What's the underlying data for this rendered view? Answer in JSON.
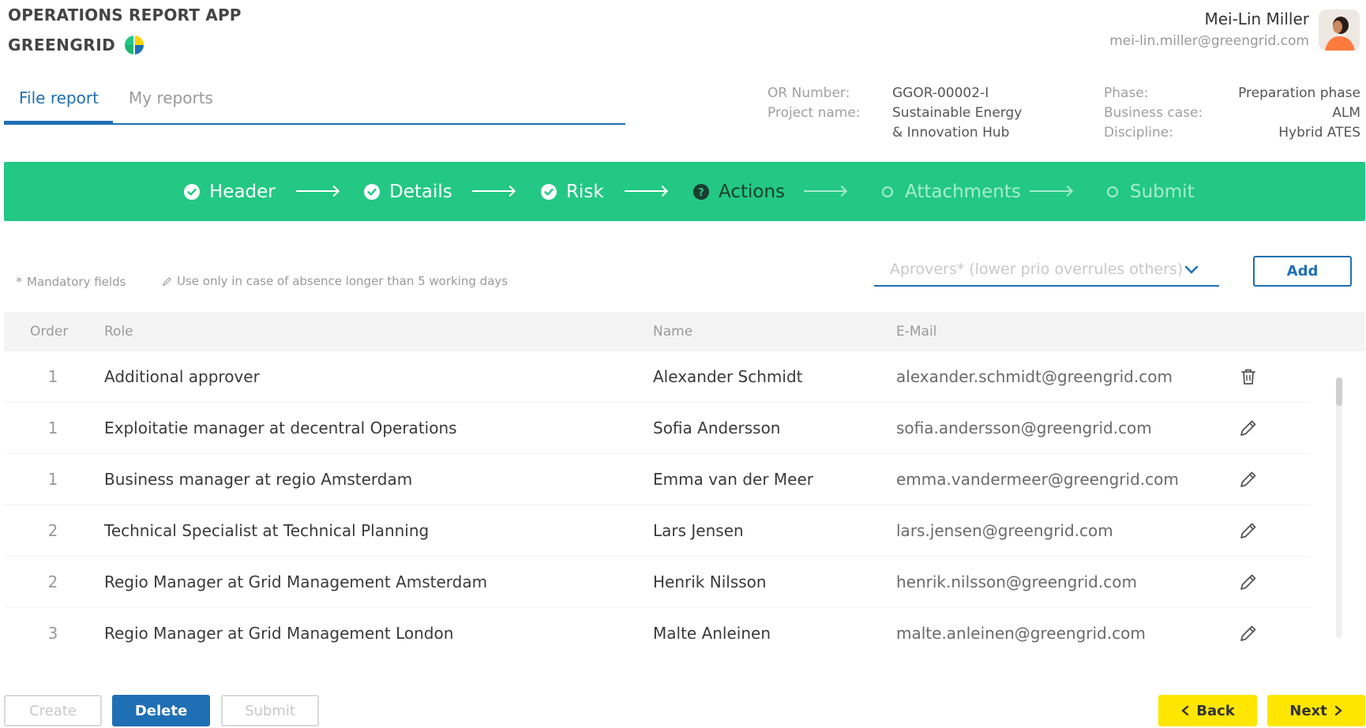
{
  "app": {
    "title": "OPERATIONS REPORT APP",
    "brand": "GREENGRID"
  },
  "user": {
    "name": "Mei-Lin Miller",
    "email": "mei-lin.miller@greengrid.com"
  },
  "tabs": [
    {
      "label": "File report",
      "active": true
    },
    {
      "label": "My reports",
      "active": false
    }
  ],
  "report": {
    "or_number_label": "OR Number:",
    "or_number": "GGOR-00002-I",
    "project_label": "Project name:",
    "project_line1": "Sustainable Energy",
    "project_line2": "& Innovation Hub",
    "phase_label": "Phase:",
    "phase": "Preparation phase",
    "business_case_label": "Business case:",
    "business_case": "ALM",
    "discipline_label": "Discipline:",
    "discipline": "Hybrid ATES"
  },
  "steps": [
    {
      "label": "Header",
      "state": "done"
    },
    {
      "label": "Details",
      "state": "done"
    },
    {
      "label": "Risk",
      "state": "done"
    },
    {
      "label": "Actions",
      "state": "current"
    },
    {
      "label": "Attachments",
      "state": "future"
    },
    {
      "label": "Submit",
      "state": "future"
    }
  ],
  "hints": {
    "mandatory": "Mandatory fields",
    "absence": "Use only in case of absence longer than 5 working days"
  },
  "approver_select": {
    "placeholder": "Aprovers* (lower prio overrules others)"
  },
  "add_label": "Add",
  "table": {
    "headers": {
      "order": "Order",
      "role": "Role",
      "name": "Name",
      "email": "E-Mail"
    },
    "rows": [
      {
        "order": "1",
        "role": "Additional approver",
        "name": "Alexander Schmidt",
        "email": "alexander.schmidt@greengrid.com",
        "action": "delete"
      },
      {
        "order": "1",
        "role": "Exploitatie manager at decentral Operations",
        "name": "Sofia Andersson",
        "email": "sofia.andersson@greengrid.com",
        "action": "edit"
      },
      {
        "order": "1",
        "role": "Business manager at regio Amsterdam",
        "name": "Emma van der Meer",
        "email": "emma.vandermeer@greengrid.com",
        "action": "edit"
      },
      {
        "order": "2",
        "role": "Technical Specialist at Technical Planning",
        "name": "Lars Jensen",
        "email": "lars.jensen@greengrid.com",
        "action": "edit"
      },
      {
        "order": "2",
        "role": "Regio Manager at Grid Management Amsterdam",
        "name": "Henrik Nilsson",
        "email": "henrik.nilsson@greengrid.com",
        "action": "edit"
      },
      {
        "order": "3",
        "role": "Regio Manager at Grid Management London",
        "name": "Malte Anleinen",
        "email": "malte.anleinen@greengrid.com",
        "action": "edit"
      }
    ]
  },
  "footer": {
    "create": "Create",
    "delete": "Delete",
    "submit": "Submit",
    "back": "Back",
    "next": "Next"
  },
  "colors": {
    "accent": "#1f6fb5",
    "stepper": "#22c883",
    "nav_button": "#ffe600"
  },
  "icons": {
    "done_step": "check-circle-icon",
    "current_step": "help-circle-icon",
    "future_step": "empty-circle-icon",
    "delete": "trash-icon",
    "edit": "pencil-icon"
  }
}
